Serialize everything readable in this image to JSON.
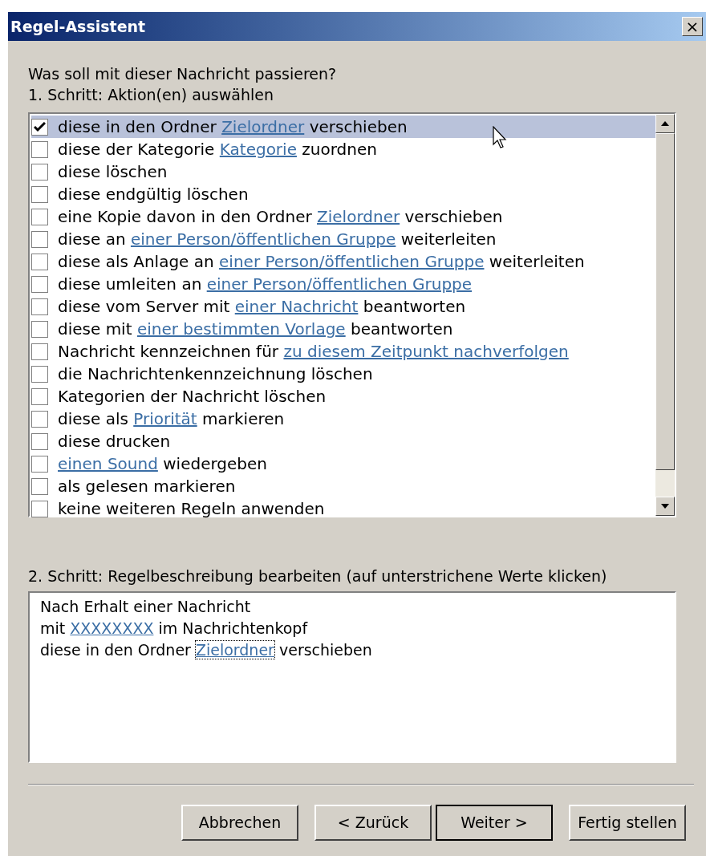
{
  "window": {
    "title": "Regel-Assistent",
    "close": "×"
  },
  "question": "Was soll mit dieser Nachricht passieren?",
  "step1": {
    "label": "1. Schritt: Aktion(en) auswählen",
    "actions": [
      {
        "checked": true,
        "selected": true,
        "parts": [
          {
            "text": "diese in den Ordner"
          },
          {
            "text": "Zielordner",
            "link": true
          },
          {
            "text": "verschieben"
          }
        ]
      },
      {
        "checked": false,
        "selected": false,
        "parts": [
          {
            "text": "diese der Kategorie"
          },
          {
            "text": "Kategorie",
            "link": true
          },
          {
            "text": "zuordnen"
          }
        ]
      },
      {
        "checked": false,
        "selected": false,
        "parts": [
          {
            "text": "diese löschen"
          }
        ]
      },
      {
        "checked": false,
        "selected": false,
        "parts": [
          {
            "text": "diese endgültig löschen"
          }
        ]
      },
      {
        "checked": false,
        "selected": false,
        "parts": [
          {
            "text": "eine Kopie davon in den Ordner"
          },
          {
            "text": "Zielordner",
            "link": true
          },
          {
            "text": "verschieben"
          }
        ]
      },
      {
        "checked": false,
        "selected": false,
        "parts": [
          {
            "text": "diese an"
          },
          {
            "text": "einer Person/öffentlichen Gruppe",
            "link": true
          },
          {
            "text": "weiterleiten"
          }
        ]
      },
      {
        "checked": false,
        "selected": false,
        "parts": [
          {
            "text": "diese als Anlage an"
          },
          {
            "text": "einer Person/öffentlichen Gruppe",
            "link": true
          },
          {
            "text": "weiterleiten"
          }
        ]
      },
      {
        "checked": false,
        "selected": false,
        "parts": [
          {
            "text": "diese umleiten an"
          },
          {
            "text": "einer Person/öffentlichen Gruppe",
            "link": true
          }
        ]
      },
      {
        "checked": false,
        "selected": false,
        "parts": [
          {
            "text": "diese vom Server mit"
          },
          {
            "text": "einer Nachricht",
            "link": true
          },
          {
            "text": "beantworten"
          }
        ]
      },
      {
        "checked": false,
        "selected": false,
        "parts": [
          {
            "text": "diese mit"
          },
          {
            "text": "einer bestimmten Vorlage",
            "link": true
          },
          {
            "text": "beantworten"
          }
        ]
      },
      {
        "checked": false,
        "selected": false,
        "parts": [
          {
            "text": "Nachricht kennzeichnen für"
          },
          {
            "text": "zu diesem Zeitpunkt nachverfolgen",
            "link": true
          }
        ]
      },
      {
        "checked": false,
        "selected": false,
        "parts": [
          {
            "text": "die Nachrichtenkennzeichnung löschen"
          }
        ]
      },
      {
        "checked": false,
        "selected": false,
        "parts": [
          {
            "text": "Kategorien der Nachricht löschen"
          }
        ]
      },
      {
        "checked": false,
        "selected": false,
        "parts": [
          {
            "text": "diese als"
          },
          {
            "text": "Priorität",
            "link": true
          },
          {
            "text": "markieren"
          }
        ]
      },
      {
        "checked": false,
        "selected": false,
        "parts": [
          {
            "text": "diese drucken"
          }
        ]
      },
      {
        "checked": false,
        "selected": false,
        "parts": [
          {
            "text": "einen Sound",
            "link": true
          },
          {
            "text": "wiedergeben"
          }
        ]
      },
      {
        "checked": false,
        "selected": false,
        "parts": [
          {
            "text": "als gelesen markieren"
          }
        ]
      },
      {
        "checked": false,
        "selected": false,
        "parts": [
          {
            "text": "keine weiteren Regeln anwenden"
          }
        ]
      }
    ]
  },
  "step2": {
    "label": "2. Schritt: Regelbeschreibung bearbeiten (auf unterstrichene Werte klicken)",
    "lines": [
      [
        {
          "text": "Nach Erhalt einer Nachricht"
        }
      ],
      [
        {
          "text": "mit"
        },
        {
          "text": "XXXXXXXX",
          "link": true
        },
        {
          "text": "im Nachrichtenkopf"
        }
      ],
      [
        {
          "text": "diese in den Ordner"
        },
        {
          "text": "Zielordner",
          "link": true,
          "focused": true
        },
        {
          "text": "verschieben"
        }
      ]
    ]
  },
  "buttons": [
    {
      "label": "Abbrechen",
      "default": false
    },
    {
      "label": "< Zurück",
      "default": false
    },
    {
      "label": "Weiter >",
      "default": true
    },
    {
      "label": "Fertig stellen",
      "default": false
    }
  ]
}
